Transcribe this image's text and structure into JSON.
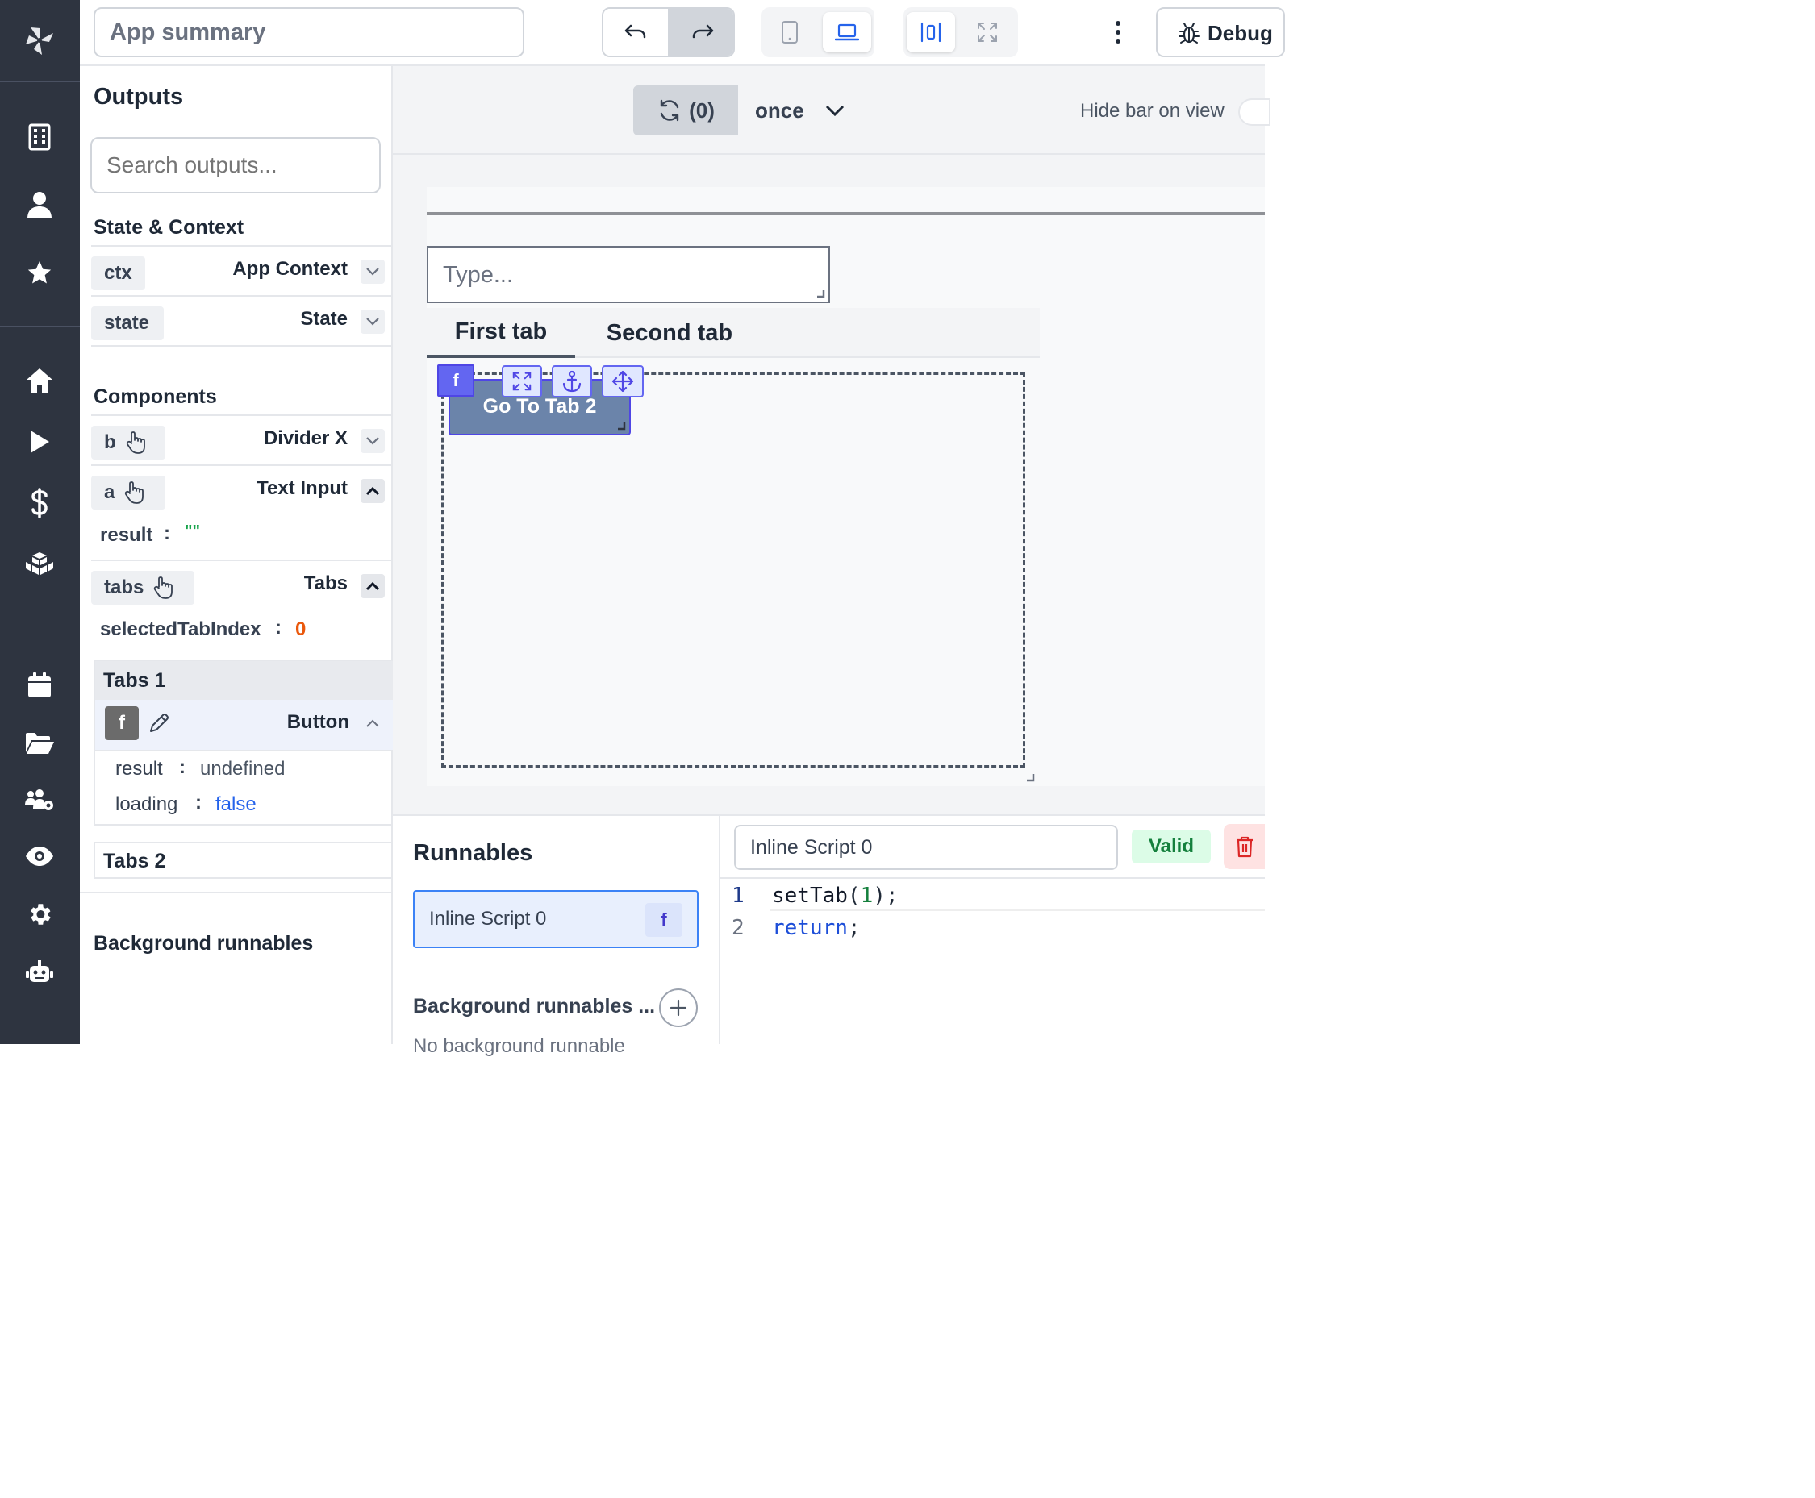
{
  "header": {
    "app_title": "App summary",
    "debug_label": "Debug"
  },
  "canvas_bar": {
    "refresh_count": "(0)",
    "refresh_mode": "once",
    "hide_bar_label": "Hide bar on view"
  },
  "outputs": {
    "title": "Outputs",
    "search_placeholder": "Search outputs...",
    "state_context_title": "State & Context",
    "ctx": {
      "tag": "ctx",
      "label": "App Context"
    },
    "state": {
      "tag": "state",
      "label": "State"
    },
    "components_title": "Components",
    "divider": {
      "tag": "b",
      "label": "Divider X"
    },
    "text_input": {
      "tag": "a",
      "label": "Text Input",
      "result_key": "result",
      "result_value": "\"\""
    },
    "tabs": {
      "tag": "tabs",
      "label": "Tabs",
      "key": "selectedTabIndex",
      "value": "0"
    },
    "tabs1": {
      "label": "Tabs 1"
    },
    "button": {
      "tag": "f",
      "label": "Button",
      "result_key": "result",
      "result_value": "undefined",
      "loading_key": "loading",
      "loading_value": "false"
    },
    "tabs2": {
      "label": "Tabs 2"
    },
    "background_title": "Background runnables"
  },
  "canvas": {
    "text_input_placeholder": "Type...",
    "tab1": "First tab",
    "tab2": "Second tab",
    "button_label": "Go To Tab 2",
    "badge": "f"
  },
  "runnables": {
    "title": "Runnables",
    "item_label": "Inline Script 0",
    "item_badge": "f",
    "background_title": "Background runnables ...",
    "background_empty": "No background runnable"
  },
  "editor": {
    "script_name": "Inline Script 0",
    "valid_label": "Valid",
    "line1_no": "1",
    "line2_no": "2",
    "line1_fn": "setTab",
    "line1_open": "(",
    "line1_arg": "1",
    "line1_close": ");",
    "line2_kw": "return",
    "line2_end": ";"
  }
}
